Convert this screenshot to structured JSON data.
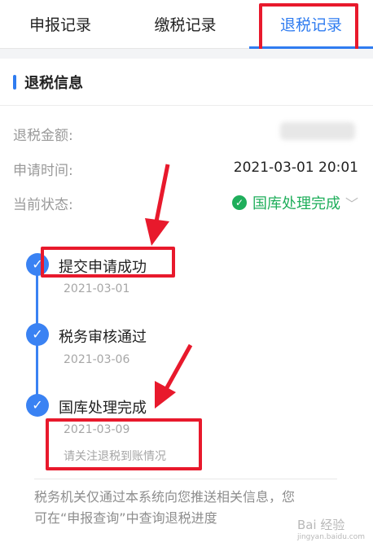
{
  "tabs": [
    {
      "label": "申报记录"
    },
    {
      "label": "缴税记录"
    },
    {
      "label": "退税记录"
    }
  ],
  "section": {
    "title": "退税信息"
  },
  "info": {
    "amount_label": "退税金额:",
    "time_label": "申请时间:",
    "time_value": "2021-03-01 20:01",
    "status_label": "当前状态:",
    "status_value": "国库处理完成"
  },
  "timeline": [
    {
      "title": "提交申请成功",
      "date": "2021-03-01"
    },
    {
      "title": "税务审核通过",
      "date": "2021-03-06"
    },
    {
      "title": "国库处理完成",
      "date": "2021-03-09",
      "note": "请关注退税到账情况"
    }
  ],
  "footer": {
    "line1": "税务机关仅通过本系统向您推送相关信息，您",
    "line2": "可在“申报查询”中查询退税进度"
  },
  "watermark": {
    "text": "Bai 经验",
    "url": "jingyan.baidu.com"
  },
  "colors": {
    "accent": "#2f7cf0",
    "success": "#1fae5b",
    "annotation": "#e8192c"
  }
}
